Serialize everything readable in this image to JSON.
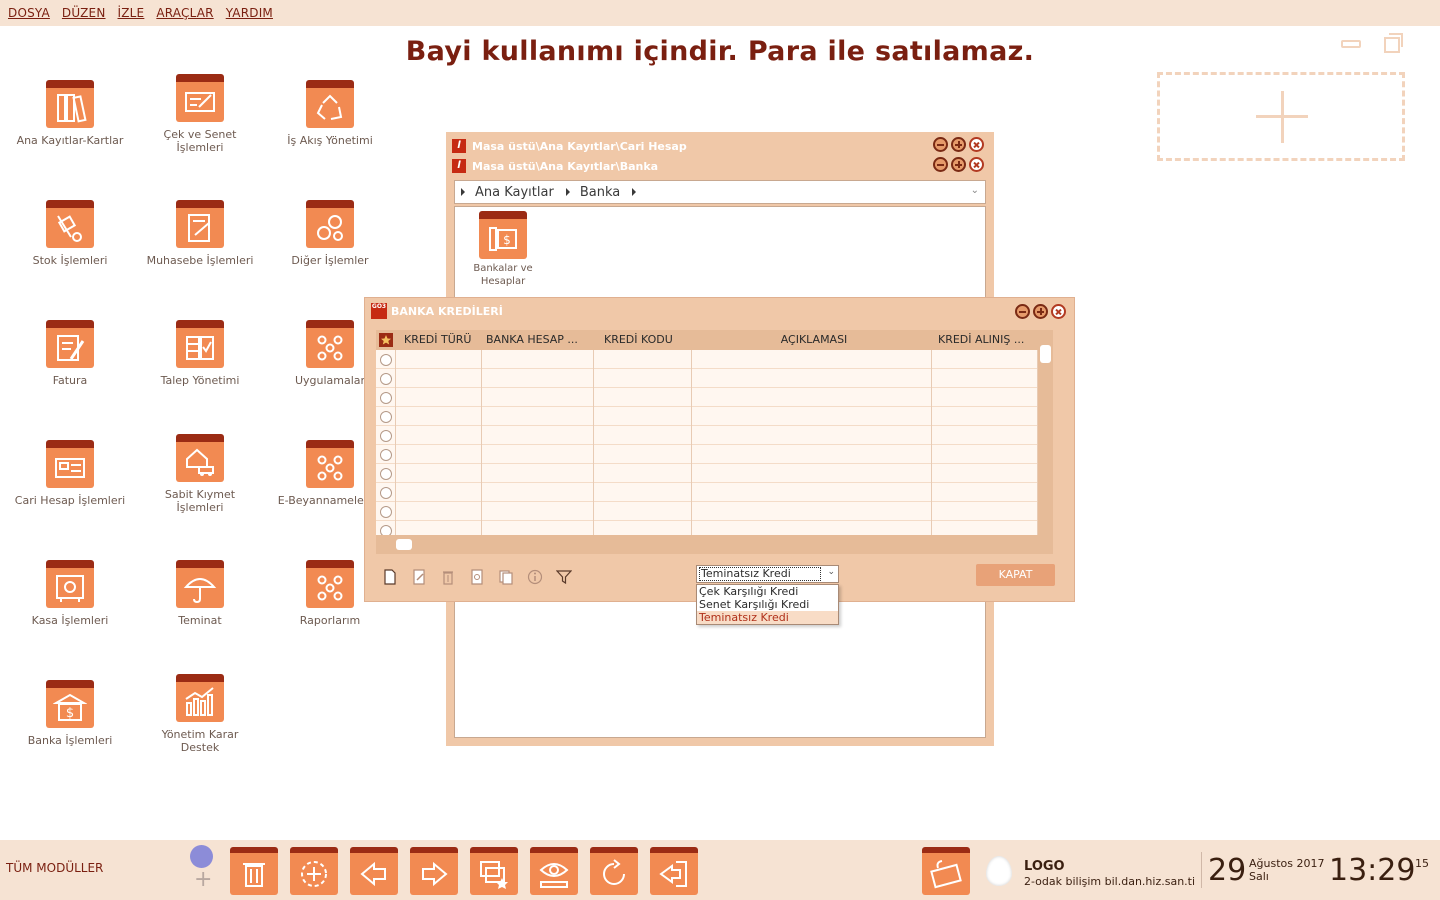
{
  "menu": [
    "DOSYA",
    "DÜZEN",
    "İZLE",
    "ARAÇLAR",
    "YARDIM"
  ],
  "banner": "Bayi kullanımı içindir. Para ile satılamaz.",
  "desktop_icons": [
    {
      "label": "Ana Kayıtlar-Kartlar",
      "icon": "binders-icon"
    },
    {
      "label": "Çek ve Senet İşlemleri",
      "icon": "cheque-icon"
    },
    {
      "label": "İş Akış Yönetimi",
      "icon": "recycle-icon"
    },
    {
      "label": "Stok İşlemleri",
      "icon": "hand-truck-icon"
    },
    {
      "label": "Muhasebe İşlemleri",
      "icon": "ledger-icon"
    },
    {
      "label": "Diğer İşlemler",
      "icon": "gears-icon"
    },
    {
      "label": "Fatura",
      "icon": "invoice-icon"
    },
    {
      "label": "Talep Yönetimi",
      "icon": "checklist-icon"
    },
    {
      "label": "Uygulamalar",
      "icon": "apps-icon"
    },
    {
      "label": "Cari Hesap İşlemleri",
      "icon": "card-icon"
    },
    {
      "label": "Sabit Kıymet İşlemleri",
      "icon": "house-car-icon"
    },
    {
      "label": "E-Beyannameler",
      "icon": "apps-icon"
    },
    {
      "label": "Kasa İşlemleri",
      "icon": "safe-icon"
    },
    {
      "label": "Teminat",
      "icon": "umbrella-icon"
    },
    {
      "label": "Raporlarım",
      "icon": "apps-icon"
    },
    {
      "label": "Banka İşlemleri",
      "icon": "bank-icon"
    },
    {
      "label": "Yönetim Karar Destek",
      "icon": "chart-icon"
    }
  ],
  "bg_window": {
    "title1": "Masa üstü\\Ana Kayıtlar\\Cari Hesap",
    "title2": "Masa üstü\\Ana Kayıtlar\\Banka",
    "crumb1": "Ana Kayıtlar",
    "crumb2": "Banka",
    "icon_label": "Bankalar ve Hesaplar"
  },
  "dialog": {
    "title": "BANKA KREDİLERİ",
    "columns": [
      "KREDİ TÜRÜ",
      "BANKA HESAP ...",
      "KREDİ KODU",
      "AÇIKLAMASI",
      "KREDİ ALINIŞ ..."
    ],
    "row_count": 10,
    "combo_value": "Teminatsız Kredi",
    "combo_options": [
      "Çek Karşılığı Kredi",
      "Senet Karşılığı Kredi",
      "Teminatsız Kredi"
    ],
    "close_button": "KAPAT"
  },
  "taskbar": {
    "all_modules": "TÜM MODÜLLER",
    "logo_title": "LOGO",
    "logo_sub": "2-odak bilişim bil.dan.hiz.san.ti",
    "day": "29",
    "month_year": "Ağustos 2017",
    "weekday": "Salı",
    "time": "13:29",
    "seconds": "15"
  },
  "colors": {
    "accent": "#f28a52",
    "dark": "#9b2b14",
    "panel": "#f0c8a8",
    "bar": "#f6e3d3"
  }
}
